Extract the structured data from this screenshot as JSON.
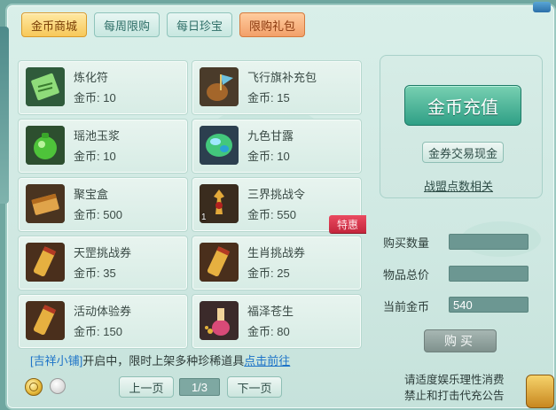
{
  "tabs": [
    {
      "label": "金币商城",
      "style": "active"
    },
    {
      "label": "每周限购",
      "style": "normal"
    },
    {
      "label": "每日珍宝",
      "style": "normal"
    },
    {
      "label": "限购礼包",
      "style": "special"
    }
  ],
  "price_label": "金币: ",
  "items": [
    {
      "name": "炼化符",
      "price": "10",
      "icon": "talisman-icon"
    },
    {
      "name": "飞行旗补充包",
      "price": "15",
      "icon": "flag-bag-icon"
    },
    {
      "name": "瑶池玉浆",
      "price": "10",
      "icon": "green-jade-icon"
    },
    {
      "name": "九色甘露",
      "price": "10",
      "icon": "nectar-icon"
    },
    {
      "name": "聚宝盒",
      "price": "500",
      "icon": "treasure-box-icon"
    },
    {
      "name": "三界挑战令",
      "price": "550",
      "icon": "challenge-token-icon",
      "qty": "1",
      "badge": "特惠"
    },
    {
      "name": "天罡挑战券",
      "price": "35",
      "icon": "scroll-icon"
    },
    {
      "name": "生肖挑战券",
      "price": "25",
      "icon": "scroll-icon"
    },
    {
      "name": "活动体验券",
      "price": "150",
      "icon": "scroll-icon"
    },
    {
      "name": "福泽苍生",
      "price": "80",
      "icon": "potion-bottle-icon"
    }
  ],
  "right_panel": {
    "recharge_label": "金币充值",
    "exchange_label": "金券交易现金",
    "points_link": "战盟点数相关"
  },
  "purchase": {
    "qty_label": "购买数量",
    "total_label": "物品总价",
    "current_label": "当前金币",
    "qty_value": "",
    "total_value": "",
    "current_value": "540",
    "buy_label": "购买"
  },
  "notice": {
    "prefix": "[吉祥小铺]",
    "text": "开启中，限时上架多种珍稀道具",
    "link": "点击前往"
  },
  "pager": {
    "prev": "上一页",
    "indicator": "1/3",
    "next": "下一页"
  },
  "disclaimer": {
    "line1": "请适度娱乐理性消费",
    "line2": "禁止和打击代充公告"
  },
  "colors": {
    "accent_teal": "#2f9f86",
    "tab_active": "#f7c85a",
    "badge_red": "#c4263c",
    "link_blue": "#1e74c8"
  }
}
